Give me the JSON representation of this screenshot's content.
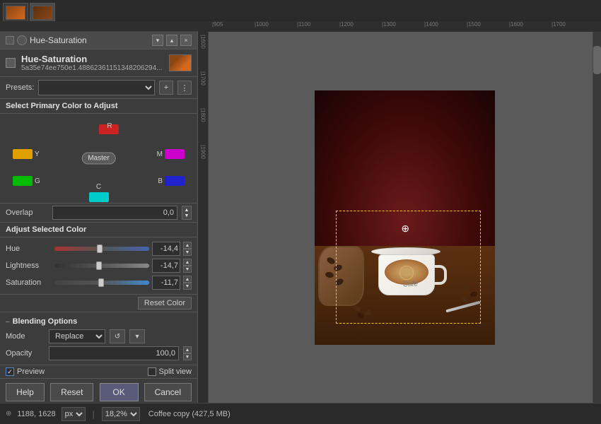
{
  "window": {
    "title": "Hue-Saturation",
    "min_btn": "–",
    "max_btn": "□",
    "close_btn": "×",
    "chevron_down": "▾",
    "chevron_up": "▴"
  },
  "dialog": {
    "title": "Hue-Saturation",
    "name": "Hue-Saturation",
    "hash": "5a35e74ee750e1.48862361151348206294...",
    "icon_alt": "hue-saturation-icon"
  },
  "presets": {
    "label": "Presets:",
    "placeholder": "",
    "add_btn": "+",
    "options_btn": "⋮"
  },
  "color_select": {
    "label": "Select Primary Color to Adjust",
    "colors": {
      "R": {
        "label": "R",
        "color": "#cc2222"
      },
      "Y": {
        "label": "Y",
        "color": "#e0a000"
      },
      "M": {
        "label": "M",
        "color": "#cc00cc"
      },
      "Master": {
        "label": "Master"
      },
      "G": {
        "label": "G",
        "color": "#00bb00"
      },
      "B": {
        "label": "B",
        "color": "#2222cc"
      },
      "C": {
        "label": "C",
        "color": "#00cccc"
      }
    }
  },
  "overlap": {
    "label": "Overlap",
    "value": "0,0"
  },
  "adjust": {
    "label": "Adjust Selected Color",
    "hue": {
      "label": "Hue",
      "value": "-14,4",
      "thumb_pct": 45
    },
    "lightness": {
      "label": "Lightness",
      "value": "-14,7",
      "thumb_pct": 44
    },
    "saturation": {
      "label": "Saturation",
      "value": "-11,7",
      "thumb_pct": 46
    },
    "reset_btn": "Reset Color"
  },
  "blending": {
    "header": "Blending Options",
    "mode_label": "Mode",
    "mode_value": "Replace",
    "opacity_label": "Opacity",
    "opacity_value": "100,0",
    "chevron": "▾",
    "icon_btn": "↺"
  },
  "preview": {
    "preview_label": "Preview",
    "preview_checked": true,
    "split_label": "Split view",
    "split_checked": false
  },
  "buttons": {
    "help": "Help",
    "reset": "Reset",
    "ok": "OK",
    "cancel": "Cancel"
  },
  "status": {
    "coords": "1188, 1628",
    "unit": "px",
    "zoom": "18,2%",
    "filename": "Coffee copy (427,5 MB)"
  },
  "canvas": {
    "cafe_text": "Café"
  },
  "icons": {
    "chevron_down": "▾",
    "minus": "—",
    "up_arrow": "▲",
    "down_arrow": "▼",
    "crosshair": "⊕",
    "collapse": "–",
    "options": "⋮"
  }
}
